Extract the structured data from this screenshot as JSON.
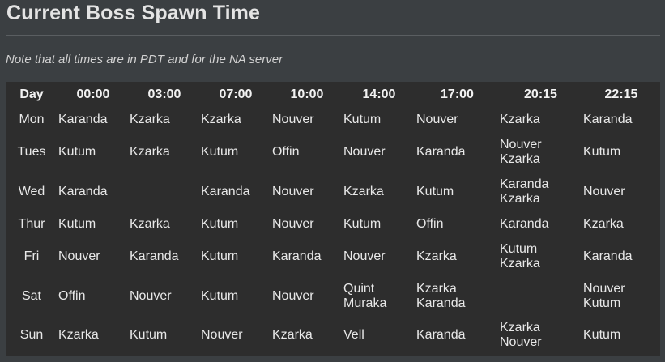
{
  "page": {
    "title": "Current Boss Spawn Time",
    "note": "Note that all times are in PDT and for the NA server"
  },
  "schedule": {
    "headers": [
      "Day",
      "00:00",
      "03:00",
      "07:00",
      "10:00",
      "14:00",
      "17:00",
      "20:15",
      "22:15"
    ],
    "rows": [
      {
        "day": "Mon",
        "cells": [
          [
            "Karanda"
          ],
          [
            "Kzarka"
          ],
          [
            "Kzarka"
          ],
          [
            "Nouver"
          ],
          [
            "Kutum"
          ],
          [
            "Nouver"
          ],
          [
            "Kzarka"
          ],
          [
            "Karanda"
          ]
        ]
      },
      {
        "day": "Tues",
        "cells": [
          [
            "Kutum"
          ],
          [
            "Kzarka"
          ],
          [
            "Kutum"
          ],
          [
            "Offin"
          ],
          [
            "Nouver"
          ],
          [
            "Karanda"
          ],
          [
            "Nouver",
            "Kzarka"
          ],
          [
            "Kutum"
          ]
        ]
      },
      {
        "day": "Wed",
        "cells": [
          [
            "Karanda"
          ],
          [],
          [
            "Karanda"
          ],
          [
            "Nouver"
          ],
          [
            "Kzarka"
          ],
          [
            "Kutum"
          ],
          [
            "Karanda",
            "Kzarka"
          ],
          [
            "Nouver"
          ]
        ]
      },
      {
        "day": "Thur",
        "cells": [
          [
            "Kutum"
          ],
          [
            "Kzarka"
          ],
          [
            "Kutum"
          ],
          [
            "Nouver"
          ],
          [
            "Kutum"
          ],
          [
            "Offin"
          ],
          [
            "Karanda"
          ],
          [
            "Kzarka"
          ]
        ]
      },
      {
        "day": "Fri",
        "cells": [
          [
            "Nouver"
          ],
          [
            "Karanda"
          ],
          [
            "Kutum"
          ],
          [
            "Karanda"
          ],
          [
            "Nouver"
          ],
          [
            "Kzarka"
          ],
          [
            "Kutum",
            "Kzarka"
          ],
          [
            "Karanda"
          ]
        ]
      },
      {
        "day": "Sat",
        "cells": [
          [
            "Offin"
          ],
          [
            "Nouver"
          ],
          [
            "Kutum"
          ],
          [
            "Nouver"
          ],
          [
            "Quint",
            "Muraka"
          ],
          [
            "Kzarka",
            "Karanda"
          ],
          [],
          [
            "Nouver",
            "Kutum"
          ]
        ]
      },
      {
        "day": "Sun",
        "cells": [
          [
            "Kzarka"
          ],
          [
            "Kutum"
          ],
          [
            "Nouver"
          ],
          [
            "Kzarka"
          ],
          [
            "Vell"
          ],
          [
            "Karanda"
          ],
          [
            "Kzarka",
            "Nouver"
          ],
          [
            "Kutum"
          ]
        ]
      }
    ]
  }
}
